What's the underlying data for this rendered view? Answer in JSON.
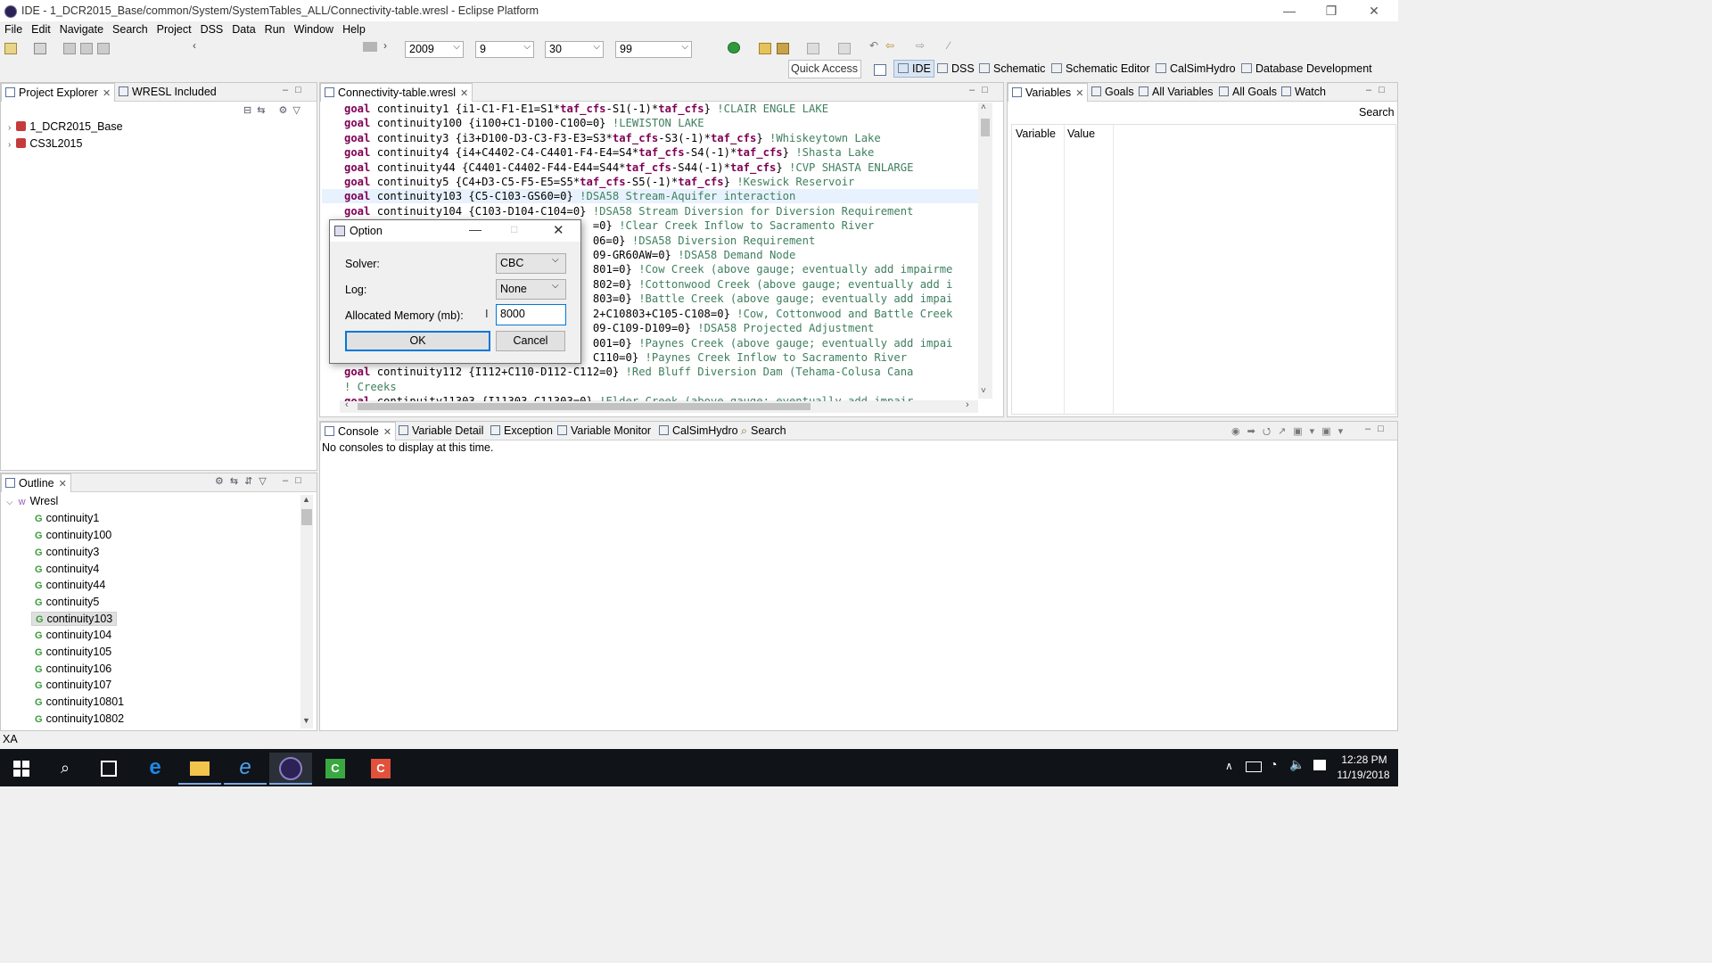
{
  "window": {
    "title": "IDE - 1_DCR2015_Base/common/System/SystemTables_ALL/Connectivity-table.wresl - Eclipse Platform"
  },
  "menu": [
    "File",
    "Edit",
    "Navigate",
    "Search",
    "Project",
    "DSS",
    "Data",
    "Run",
    "Window",
    "Help"
  ],
  "toolbar": {
    "year": "2009",
    "month": "9",
    "day": "30",
    "cycles": "99",
    "quick_access": "Quick Access"
  },
  "perspectives": [
    "IDE",
    "DSS",
    "Schematic",
    "Schematic Editor",
    "CalSimHydro",
    "Database Development"
  ],
  "project_explorer": {
    "tabs": [
      "Project Explorer",
      "WRESL Included"
    ],
    "items": [
      "1_DCR2015_Base",
      "CS3L2015"
    ]
  },
  "outline": {
    "tab": "Outline",
    "root": "Wresl",
    "items": [
      "continuity1",
      "continuity100",
      "continuity3",
      "continuity4",
      "continuity44",
      "continuity5",
      "continuity103",
      "continuity104",
      "continuity105",
      "continuity106",
      "continuity107",
      "continuity10801",
      "continuity10802"
    ],
    "selected": "continuity103"
  },
  "editor": {
    "tab": "Connectivity-table.wresl"
  },
  "variables_panel": {
    "tabs": [
      "Variables",
      "Goals",
      "All Variables",
      "All Goals",
      "Watch"
    ],
    "search": "Search",
    "columns": [
      "Variable",
      "Value"
    ]
  },
  "console_panel": {
    "tabs": [
      "Console",
      "Variable Detail",
      "Exception",
      "Variable Monitor",
      "CalSimHydro",
      "Search"
    ],
    "message": "No consoles to display at this time."
  },
  "dialog": {
    "title": "Option",
    "solver_label": "Solver:",
    "solver_value": "CBC",
    "log_label": "Log:",
    "log_value": "None",
    "memory_label": "Allocated Memory (mb):",
    "memory_value": "8000",
    "ok": "OK",
    "cancel": "Cancel"
  },
  "status": "XA",
  "clock": {
    "time": "12:28 PM",
    "date": "11/19/2018"
  }
}
